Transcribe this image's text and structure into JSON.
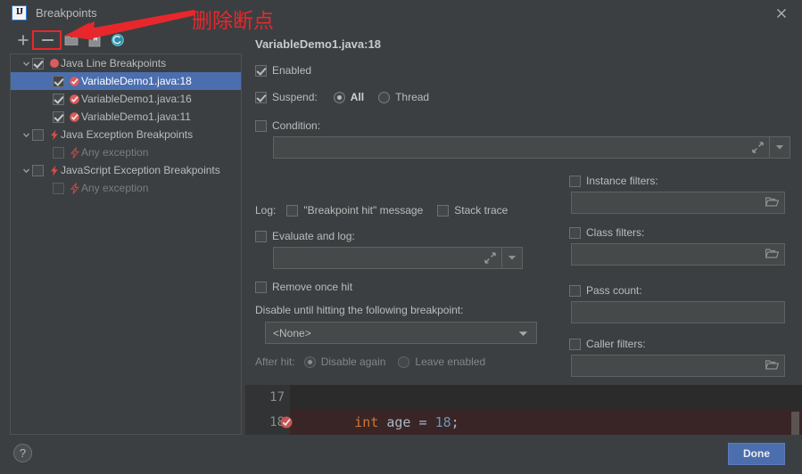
{
  "window": {
    "title": "Breakpoints",
    "logo_text": "IJ",
    "close_icon": "close-icon"
  },
  "toolbar": {
    "add_label": "+",
    "add_icon": "plus-icon",
    "remove_icon": "minus-icon",
    "group_icon": "folder-icon",
    "bookmark_icon": "bookmark-icon",
    "mute_icon": "mute-breakpoints-icon"
  },
  "annotations": {
    "delete_breakpoint_note": "删除断点",
    "note_color": "#e8272c",
    "highlight_target": "minus-icon"
  },
  "tree": {
    "groups": [
      {
        "label": "Java Line Breakpoints",
        "icon": "red-circle-breakpoint-icon",
        "checked": true,
        "expanded": true,
        "children": [
          {
            "label": "VariableDemo1.java:18",
            "icon": "line-breakpoint-icon",
            "checked": true,
            "selected": true
          },
          {
            "label": "VariableDemo1.java:16",
            "icon": "line-breakpoint-icon",
            "checked": true,
            "selected": false
          },
          {
            "label": "VariableDemo1.java:11",
            "icon": "line-breakpoint-icon",
            "checked": true,
            "selected": false
          }
        ]
      },
      {
        "label": "Java Exception Breakpoints",
        "icon": "lightning-breakpoint-icon",
        "checked": false,
        "expanded": true,
        "children": [
          {
            "label": "Any exception",
            "icon": "lightning-breakpoint-icon",
            "checked": false,
            "selected": false,
            "dim": true
          }
        ]
      },
      {
        "label": "JavaScript Exception Breakpoints",
        "icon": "lightning-breakpoint-icon",
        "checked": false,
        "expanded": true,
        "children": [
          {
            "label": "Any exception",
            "icon": "lightning-breakpoint-icon",
            "checked": false,
            "selected": false,
            "dim": true
          }
        ]
      }
    ]
  },
  "details": {
    "title": "VariableDemo1.java:18",
    "enabled": {
      "label": "Enabled",
      "checked": true
    },
    "suspend": {
      "label": "Suspend:",
      "checked": true,
      "options": [
        {
          "label": "All",
          "selected": true
        },
        {
          "label": "Thread",
          "selected": false
        }
      ]
    },
    "condition": {
      "label": "Condition:",
      "checked": false,
      "value": "",
      "expand_icon": "expand-editor-icon",
      "dropdown_icon": "chevron-down-icon"
    },
    "log": {
      "label": "Log:",
      "breakpoint_hit": {
        "label": "\"Breakpoint hit\" message",
        "checked": false
      },
      "stack_trace": {
        "label": "Stack trace",
        "checked": false
      }
    },
    "evaluate_and_log": {
      "label": "Evaluate and log:",
      "checked": false,
      "value": "",
      "expand_icon": "expand-editor-icon",
      "dropdown_icon": "chevron-down-icon"
    },
    "remove_once_hit": {
      "label": "Remove once hit",
      "checked": false
    },
    "disable_until": {
      "label": "Disable until hitting the following breakpoint:",
      "selected_value": "<None>",
      "dropdown_icon": "chevron-down-icon"
    },
    "after_hit": {
      "label": "After hit:",
      "options": [
        {
          "label": "Disable again",
          "selected": true
        },
        {
          "label": "Leave enabled",
          "selected": false
        }
      ]
    },
    "filters": [
      {
        "label": "Instance filters:",
        "checked": false,
        "value": "",
        "has_browse": true,
        "browse_icon": "folder-icon"
      },
      {
        "label": "Class filters:",
        "checked": false,
        "value": "",
        "has_browse": true,
        "browse_icon": "folder-icon"
      },
      {
        "label": "Pass count:",
        "checked": false,
        "value": "",
        "has_browse": false,
        "browse_icon": ""
      },
      {
        "label": "Caller filters:",
        "checked": false,
        "value": "",
        "has_browse": true,
        "browse_icon": "folder-icon"
      }
    ]
  },
  "code_preview": {
    "lines": [
      {
        "number": "17",
        "has_breakpoint": false,
        "highlighted": false,
        "tokens": []
      },
      {
        "number": "18",
        "has_breakpoint": true,
        "breakpoint_icon": "line-breakpoint-icon",
        "highlighted": true,
        "indent": "        ",
        "kw": "int",
        "space1": " ",
        "ident": "age",
        "op": " = ",
        "num": "18",
        "semi": ";"
      }
    ]
  },
  "footer": {
    "help_label": "?",
    "help_icon": "question-mark-icon",
    "done_label": "Done",
    "done_color": "#4b6eaf"
  }
}
